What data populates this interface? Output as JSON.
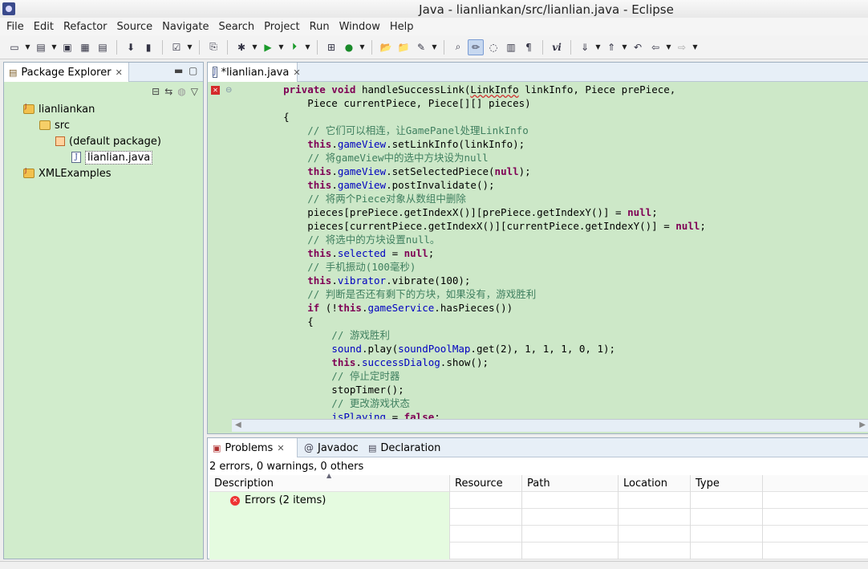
{
  "window": {
    "title": "Java - lianliankan/src/lianlian.java - Eclipse"
  },
  "menu": [
    "File",
    "Edit",
    "Refactor",
    "Source",
    "Navigate",
    "Search",
    "Project",
    "Run",
    "Window",
    "Help"
  ],
  "package_explorer": {
    "tab_label": "Package Explorer",
    "tree": [
      {
        "label": "lianliankan",
        "icon": "project-icon",
        "level": 0
      },
      {
        "label": "src",
        "icon": "source-folder-icon",
        "level": 1
      },
      {
        "label": "(default package)",
        "icon": "package-icon",
        "level": 2
      },
      {
        "label": "lianlian.java",
        "icon": "java-file-icon",
        "level": 3,
        "selected": true
      },
      {
        "label": "XMLExamples",
        "icon": "project-icon",
        "level": 0
      }
    ]
  },
  "editor": {
    "tab_label": "*lianlian.java",
    "code_lines": [
      "    private void handleSuccessLink(LinkInfo linkInfo, Piece prePiece,",
      "        Piece currentPiece, Piece[][] pieces)",
      "    {",
      "        // 它们可以相连，让GamePanel处理LinkInfo",
      "        this.gameView.setLinkInfo(linkInfo);",
      "        // 将gameView中的选中方块设为null",
      "        this.gameView.setSelectedPiece(null);",
      "        this.gameView.postInvalidate();",
      "        // 将两个Piece对象从数组中删除",
      "        pieces[prePiece.getIndexX()][prePiece.getIndexY()] = null;",
      "        pieces[currentPiece.getIndexX()][currentPiece.getIndexY()] = null;",
      "        // 将选中的方块设置null。",
      "        this.selected = null;",
      "        // 手机振动(100毫秒)",
      "        this.vibrator.vibrate(100);",
      "        // 判断是否还有剩下的方块，如果没有，游戏胜利",
      "        if (!this.gameService.hasPieces())",
      "        {",
      "            // 游戏胜利",
      "            sound.play(soundPoolMap.get(2), 1, 1, 1, 0, 1);",
      "            this.successDialog.show();",
      "            // 停止定时器",
      "            stopTimer();",
      "            // 更改游戏状态",
      "            isPlaying = false;"
    ]
  },
  "bottom_panel": {
    "tabs": [
      "Problems",
      "Javadoc",
      "Declaration"
    ],
    "summary": "2 errors, 0 warnings, 0 others",
    "columns": [
      "Description",
      "Resource",
      "Path",
      "Location",
      "Type"
    ],
    "rows": [
      {
        "description": "Errors (2 items)",
        "resource": "",
        "path": "",
        "location": "",
        "type": ""
      }
    ]
  },
  "colors": {
    "editor_bg": "#cde8c8",
    "keyword": "#7f0055",
    "field": "#0000c0",
    "comment": "#3f7f5f"
  }
}
